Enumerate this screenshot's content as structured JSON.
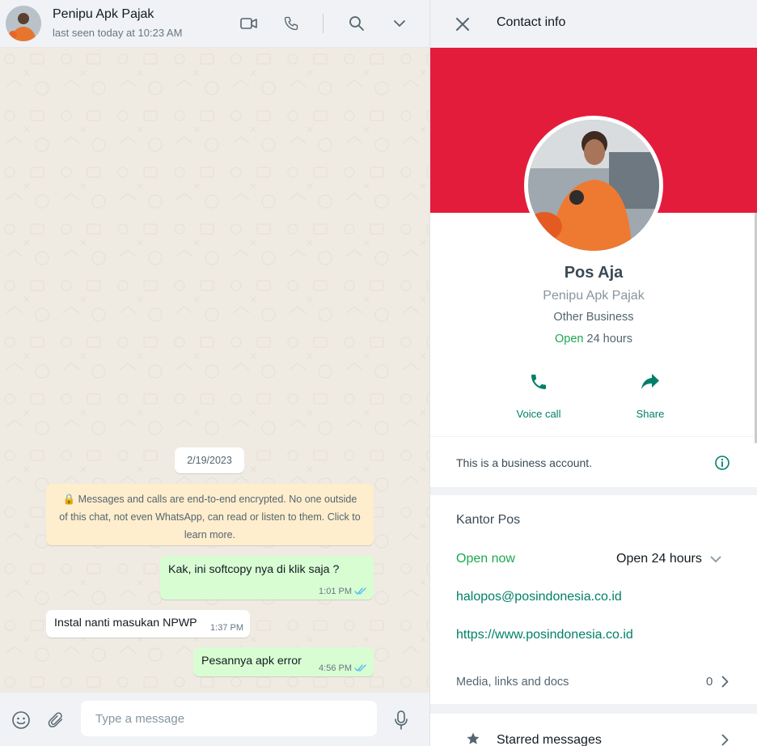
{
  "chat": {
    "title": "Penipu Apk Pajak",
    "status": "last seen today at 10:23 AM",
    "date_chip": "2/19/2023",
    "encryption_note": "🔒 Messages and calls are end-to-end encrypted. No one outside of this chat, not even WhatsApp, can read or listen to them. Click to learn more.",
    "messages": [
      {
        "direction": "out",
        "text": "Kak, ini softcopy nya di klik saja ?",
        "time": "1:01 PM",
        "status": "read"
      },
      {
        "direction": "in",
        "text": "Instal nanti masukan NPWP",
        "time": "1:37 PM"
      },
      {
        "direction": "out",
        "text": "Pesannya apk error",
        "time": "4:56 PM",
        "status": "read"
      }
    ],
    "composer_placeholder": "Type a message"
  },
  "contact_info": {
    "header_title": "Contact info",
    "name": "Pos Aja",
    "alias": "Penipu Apk Pajak",
    "category": "Other Business",
    "hours_open": "Open",
    "hours_rest": " 24 hours",
    "actions": {
      "voice_call": "Voice call",
      "share": "Share"
    },
    "business_note": "This is a business account.",
    "business_name": "Kantor Pos",
    "open_now": "Open now",
    "open_hours": "Open 24 hours",
    "email": "halopos@posindonesia.co.id",
    "website": "https://www.posindonesia.co.id",
    "media_label": "Media, links and docs",
    "media_count": "0",
    "starred_label": "Starred messages"
  },
  "colors": {
    "accent_green": "#008069",
    "open_green": "#1da851",
    "cover_red": "#e41c3c",
    "outgoing_bubble": "#d9fdd3",
    "read_tick_blue": "#53bdeb"
  }
}
